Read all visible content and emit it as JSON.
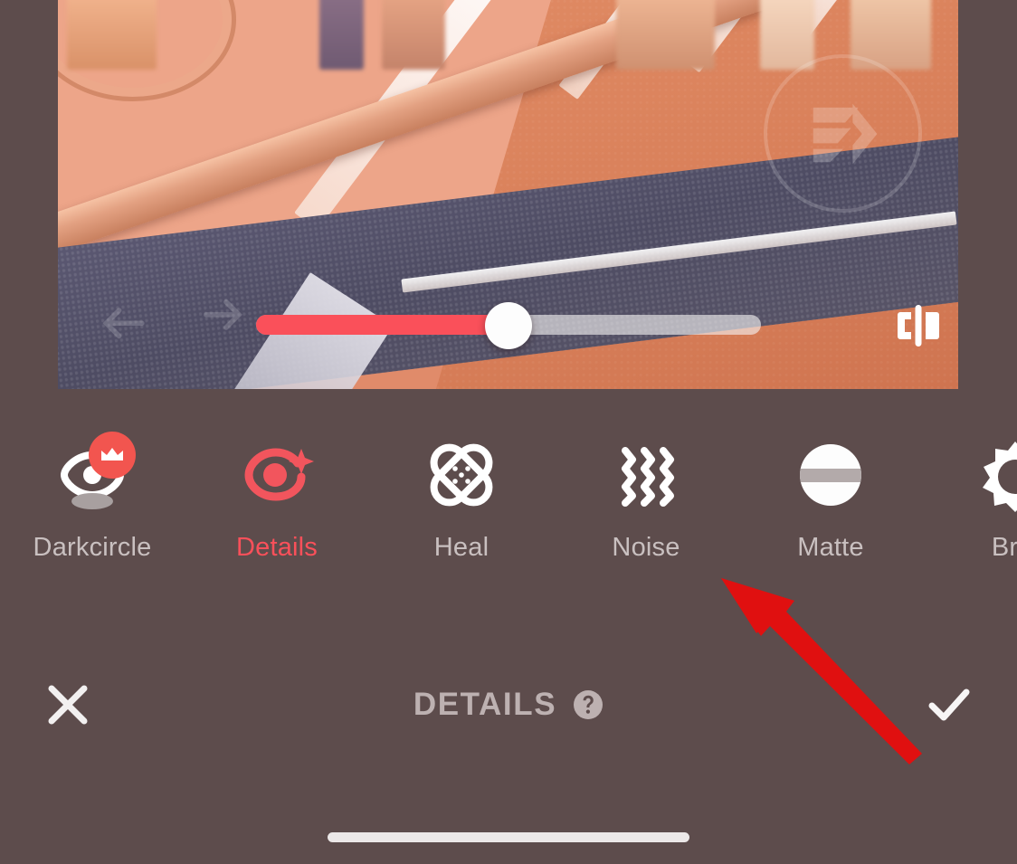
{
  "app": {
    "panel_bg": "#5d4c4c",
    "accent_red": "#fa505a",
    "annotation_arrow_color": "#e01010",
    "muted_text": "#c9c0c0"
  },
  "photo": {
    "alt_description": "Sunlit street scene: paved brick sidewalk with curb, orange asphalt road with white lane markings, dark grey asphalt strip, bicycle wheel at upper left",
    "watermark_icon": "logo-watermark-icon",
    "ghost_arrows_icon": "ghost-arrows-icon"
  },
  "slider": {
    "name": "intensity-slider",
    "value": 50,
    "min": 0,
    "max": 100,
    "fill_percent": "50%",
    "thumb_percent": "50%",
    "track_color": "#f4f2f2",
    "fill_color": "#fa505a"
  },
  "compare": {
    "name": "before-after-compare-button",
    "icon": "compare-split-icon"
  },
  "tools": [
    {
      "label": "Darkcircle",
      "icon": "eye-darkcircle-icon",
      "active": false,
      "pro": true,
      "badge_icon": "crown-icon"
    },
    {
      "label": "Details",
      "icon": "eye-sparkle-icon",
      "active": true,
      "pro": false,
      "badge_icon": ""
    },
    {
      "label": "Heal",
      "icon": "bandage-cross-icon",
      "active": false,
      "pro": false,
      "badge_icon": ""
    },
    {
      "label": "Noise",
      "icon": "wavy-lines-icon",
      "active": false,
      "pro": false,
      "badge_icon": ""
    },
    {
      "label": "Matte",
      "icon": "matte-circle-icon",
      "active": false,
      "pro": false,
      "badge_icon": ""
    },
    {
      "label": "Brig",
      "icon": "sun-brightness-icon",
      "active": false,
      "pro": false,
      "badge_icon": ""
    }
  ],
  "action_bar": {
    "cancel_icon": "close-x-icon",
    "cancel_label": "Cancel",
    "title": "DETAILS",
    "help_icon": "question-mark-circle-icon",
    "confirm_icon": "checkmark-icon",
    "confirm_label": "Apply"
  },
  "system": {
    "home_indicator": "home-indicator-bar"
  }
}
